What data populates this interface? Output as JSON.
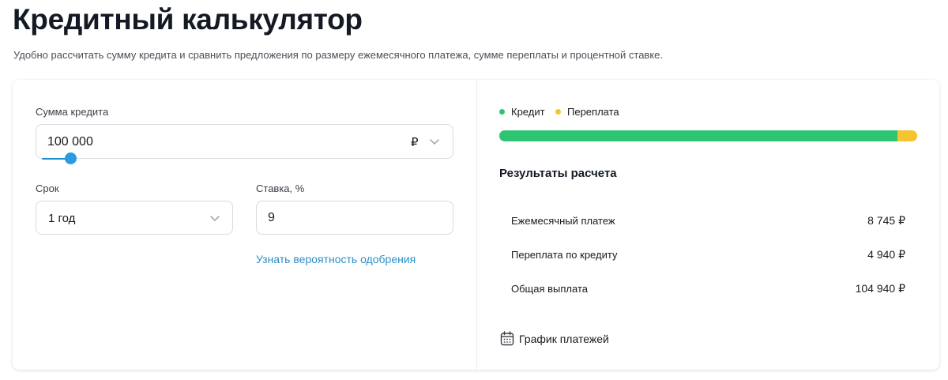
{
  "page": {
    "title": "Кредитный калькулятор",
    "subtitle": "Удобно рассчитать сумму кредита и сравнить предложения по размеру ежемесячного платежа, сумме переплаты и процентной ставке."
  },
  "form": {
    "amount_label": "Сумма кредита",
    "amount_value": "100 000",
    "currency": "₽",
    "amount_slider_fraction": 0.05,
    "term_label": "Срок",
    "term_value": "1 год",
    "rate_label": "Ставка, %",
    "rate_value": "9",
    "approval_link": "Узнать вероятность одобрения"
  },
  "chart_data": {
    "type": "bar",
    "categories": [
      "Кредит",
      "Переплата"
    ],
    "values": [
      100000,
      4940
    ],
    "colors": [
      "#2ec471",
      "#f5c530"
    ],
    "legend": [
      "Кредит",
      "Переплата"
    ]
  },
  "results": {
    "title": "Результаты расчета",
    "rows": [
      {
        "label": "Ежемесячный платеж",
        "value": "8 745 ₽"
      },
      {
        "label": "Переплата по кредиту",
        "value": "4 940 ₽"
      },
      {
        "label": "Общая выплата",
        "value": "104 940 ₽"
      }
    ],
    "schedule_label": "График платежей",
    "schedule_icon": "calendar-icon"
  }
}
